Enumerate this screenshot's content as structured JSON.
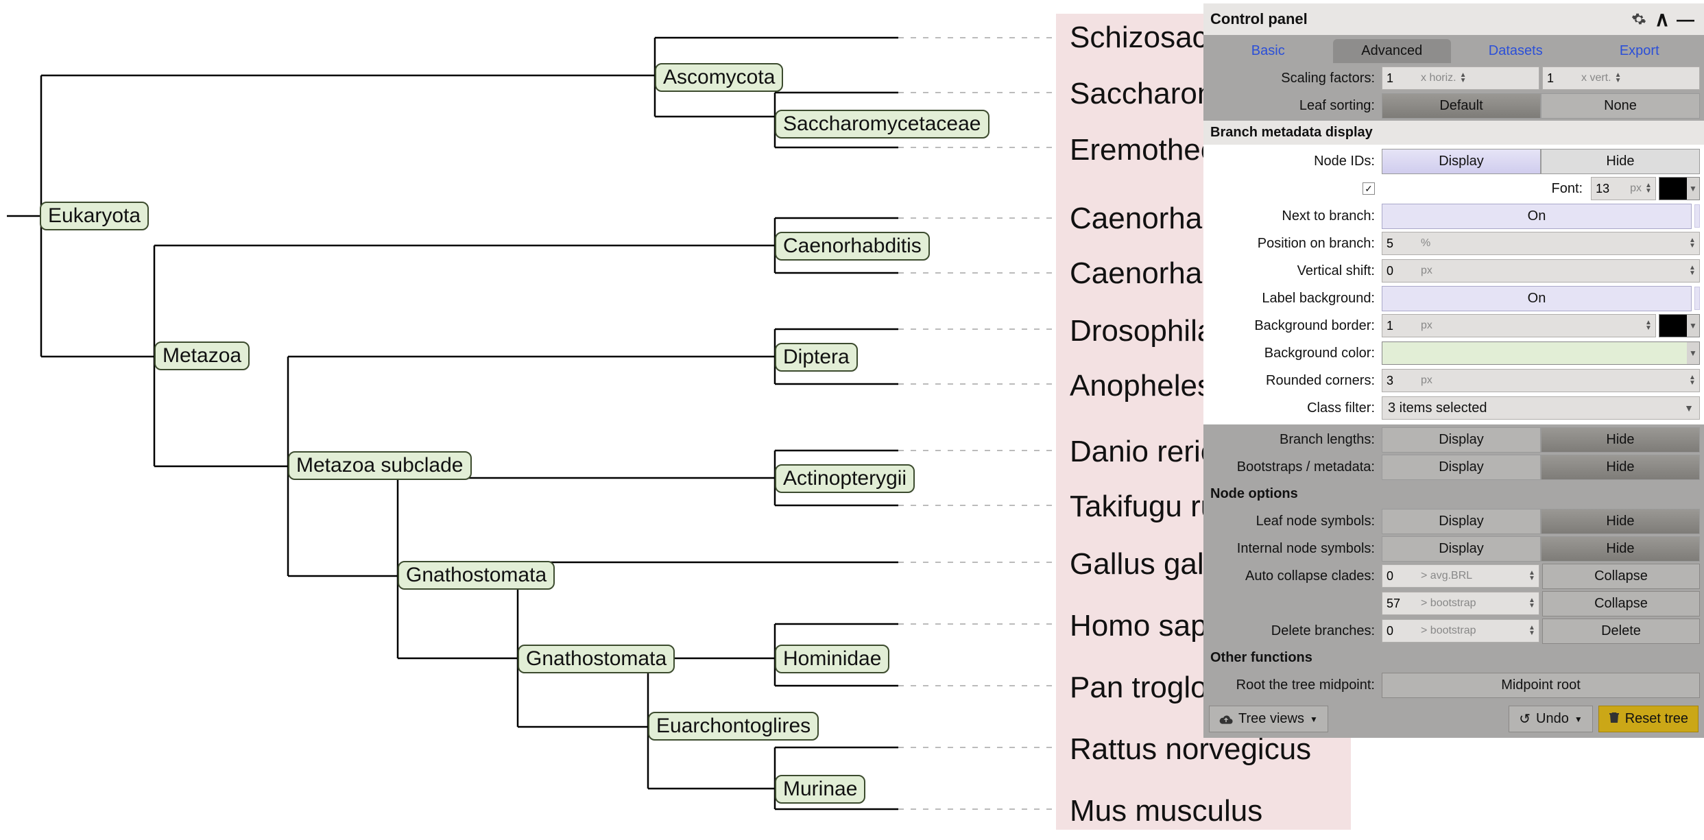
{
  "leaves": [
    "Schizosaccharomyces pombe",
    "Saccharomyces cerevisiae",
    "Eremothecium gossypii",
    "Caenorhabditis elegans",
    "Caenorhabditis briggsae",
    "Drosophila melanogaster",
    "Anopheles gambiae",
    "Danio rerio",
    "Takifugu rubripes",
    "Gallus gallus",
    "Homo sapiens",
    "Pan troglodytes",
    "Rattus norvegicus",
    "Mus musculus"
  ],
  "nodes": {
    "eukaryota": "Eukaryota",
    "ascomycota": "Ascomycota",
    "saccharomycetaceae": "Saccharomycetaceae",
    "metazoa": "Metazoa",
    "caenorhabditis": "Caenorhabditis",
    "metazoa_subclade": "Metazoa subclade",
    "diptera": "Diptera",
    "gnathostomata": "Gnathostomata",
    "actinopterygii": "Actinopterygii",
    "gnathostomata2": "Gnathostomata",
    "hominidae": "Hominidae",
    "euarchontoglires": "Euarchontoglires",
    "murinae": "Murinae"
  },
  "panel": {
    "title": "Control panel",
    "tabs": {
      "basic": "Basic",
      "advanced": "Advanced",
      "datasets": "Datasets",
      "export": "Export"
    },
    "scaling": {
      "label": "Scaling factors:",
      "h_val": "1",
      "h_unit": "x horiz.",
      "v_val": "1",
      "v_unit": "x vert."
    },
    "leaf_sorting": {
      "label": "Leaf sorting:",
      "default": "Default",
      "none": "None"
    },
    "branch_meta_title": "Branch metadata display",
    "node_ids": {
      "label": "Node IDs:",
      "display": "Display",
      "hide": "Hide"
    },
    "font": {
      "label": "Font:",
      "val": "13",
      "unit": "px"
    },
    "next_to_branch": {
      "label": "Next to branch:",
      "on": "On"
    },
    "pos_on_branch": {
      "label": "Position on branch:",
      "val": "5",
      "unit": "%"
    },
    "vshift": {
      "label": "Vertical shift:",
      "val": "0",
      "unit": "px"
    },
    "label_bg": {
      "label": "Label background:",
      "on": "On"
    },
    "bg_border": {
      "label": "Background border:",
      "val": "1",
      "unit": "px"
    },
    "bg_color": {
      "label": "Background color:"
    },
    "rounded": {
      "label": "Rounded corners:",
      "val": "3",
      "unit": "px"
    },
    "class_filter": {
      "label": "Class filter:",
      "value": "3 items selected"
    },
    "branch_lengths": {
      "label": "Branch lengths:",
      "display": "Display",
      "hide": "Hide"
    },
    "bootstraps": {
      "label": "Bootstraps / metadata:",
      "display": "Display",
      "hide": "Hide"
    },
    "node_options_title": "Node options",
    "leaf_symbols": {
      "label": "Leaf node symbols:",
      "display": "Display",
      "hide": "Hide"
    },
    "internal_symbols": {
      "label": "Internal node symbols:",
      "display": "Display",
      "hide": "Hide"
    },
    "auto_collapse": {
      "label": "Auto collapse clades:",
      "v1": "0",
      "u1": "> avg.BRL",
      "v2": "57",
      "u2": "> bootstrap",
      "btn": "Collapse"
    },
    "delete_branches": {
      "label": "Delete branches:",
      "val": "0",
      "unit": "> bootstrap",
      "btn": "Delete"
    },
    "other_title": "Other functions",
    "midpoint": {
      "label": "Root the tree midpoint:",
      "btn": "Midpoint root"
    },
    "tree_views": "Tree views",
    "undo": "Undo",
    "reset": "Reset tree"
  },
  "colors": {
    "font_color": "#000000",
    "border_color": "#000000",
    "bg_color": "#e2eed6"
  }
}
